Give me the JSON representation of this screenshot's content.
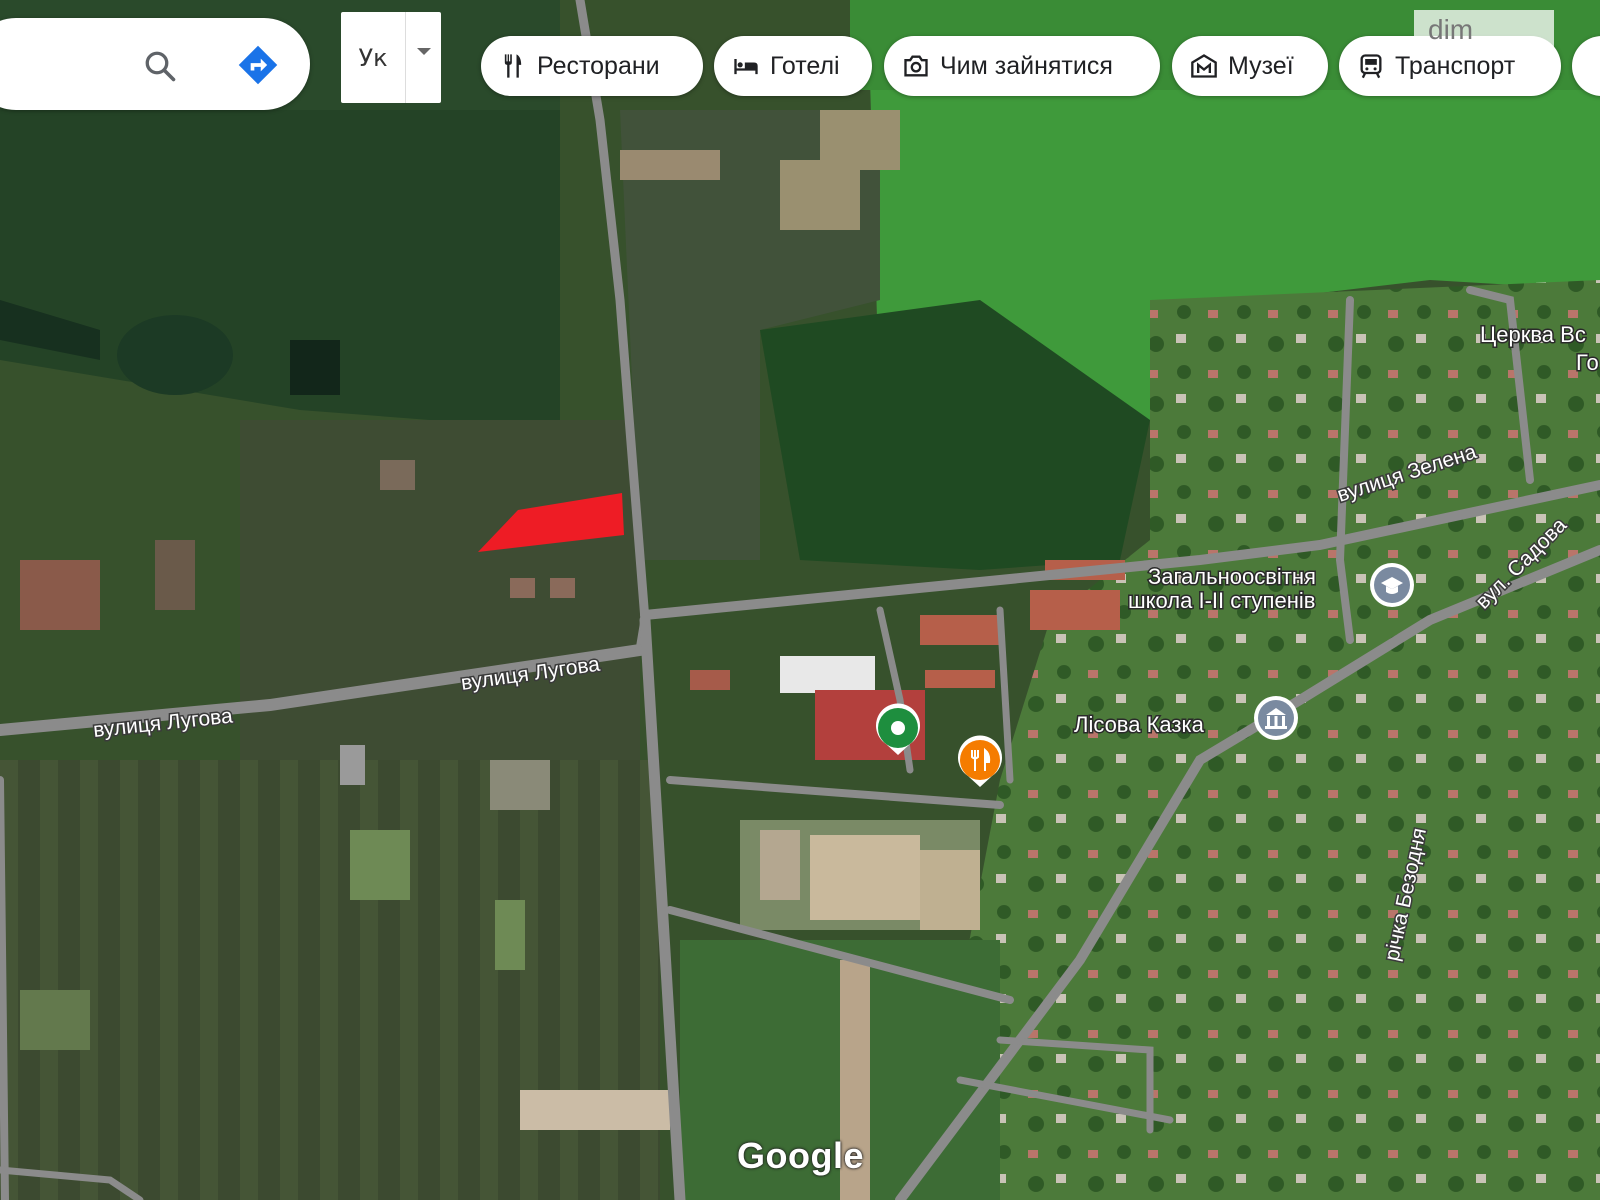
{
  "search": {
    "directions_label": "directions-icon",
    "search_label": "search-icon"
  },
  "language": {
    "code": "Ук"
  },
  "categories": [
    {
      "label": "Ресторани",
      "icon": "fork-knife-icon"
    },
    {
      "label": "Готелі",
      "icon": "bed-icon"
    },
    {
      "label": "Чим зайнятися",
      "icon": "camera-icon"
    },
    {
      "label": "Музеї",
      "icon": "museum-icon"
    },
    {
      "label": "Транспорт",
      "icon": "train-icon"
    }
  ],
  "watermark": "dim",
  "streets": {
    "luhova_left": "вулиця Лугова",
    "luhova_right": "вулиця Лугова",
    "zelena": "вулиця Зелена",
    "sadova": "вул. Садова",
    "river": "річка Безодня"
  },
  "places": {
    "church_line1": "Церква Вс",
    "church_line2": "Го",
    "school_line1": "Загальноосвітня",
    "school_line2": "школа І-ІІ ступенів",
    "forest_tale": "Лісова Казка"
  },
  "attribution": "Google",
  "colors": {
    "highlight": "#ee1c25",
    "pin_green": "#1e8e3e",
    "pin_orange": "#f57c00",
    "school_icon": "#7a8aa0"
  }
}
